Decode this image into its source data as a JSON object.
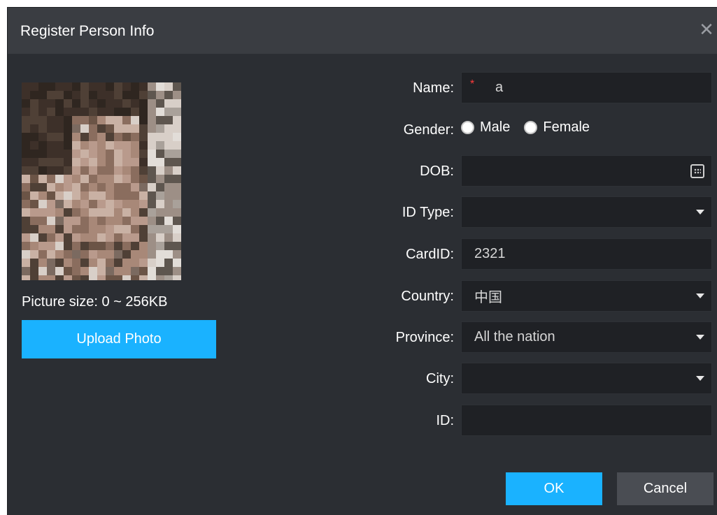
{
  "dialog": {
    "title": "Register Person Info",
    "close_icon": "close-icon"
  },
  "photo": {
    "caption": "Picture size: 0 ~ 256KB",
    "upload_label": "Upload Photo"
  },
  "form": {
    "name_label": "Name:",
    "name_required_mark": "*",
    "name_value": "a",
    "gender_label": "Gender:",
    "gender_male": "Male",
    "gender_female": "Female",
    "dob_label": "DOB:",
    "dob_value": "",
    "id_type_label": "ID Type:",
    "id_type_value": "",
    "cardid_label": "CardID:",
    "cardid_value": "2321",
    "country_label": "Country:",
    "country_value": "中国",
    "province_label": "Province:",
    "province_value": "All the nation",
    "city_label": "City:",
    "city_value": "",
    "id_label": "ID:",
    "id_value": ""
  },
  "footer": {
    "ok_label": "OK",
    "cancel_label": "Cancel"
  },
  "colors": {
    "accent": "#1ab2ff",
    "dialog_bg": "#2b2e33",
    "titlebar_bg": "#3a3d42",
    "field_bg": "#1f2125",
    "required": "#ff3b3b"
  }
}
